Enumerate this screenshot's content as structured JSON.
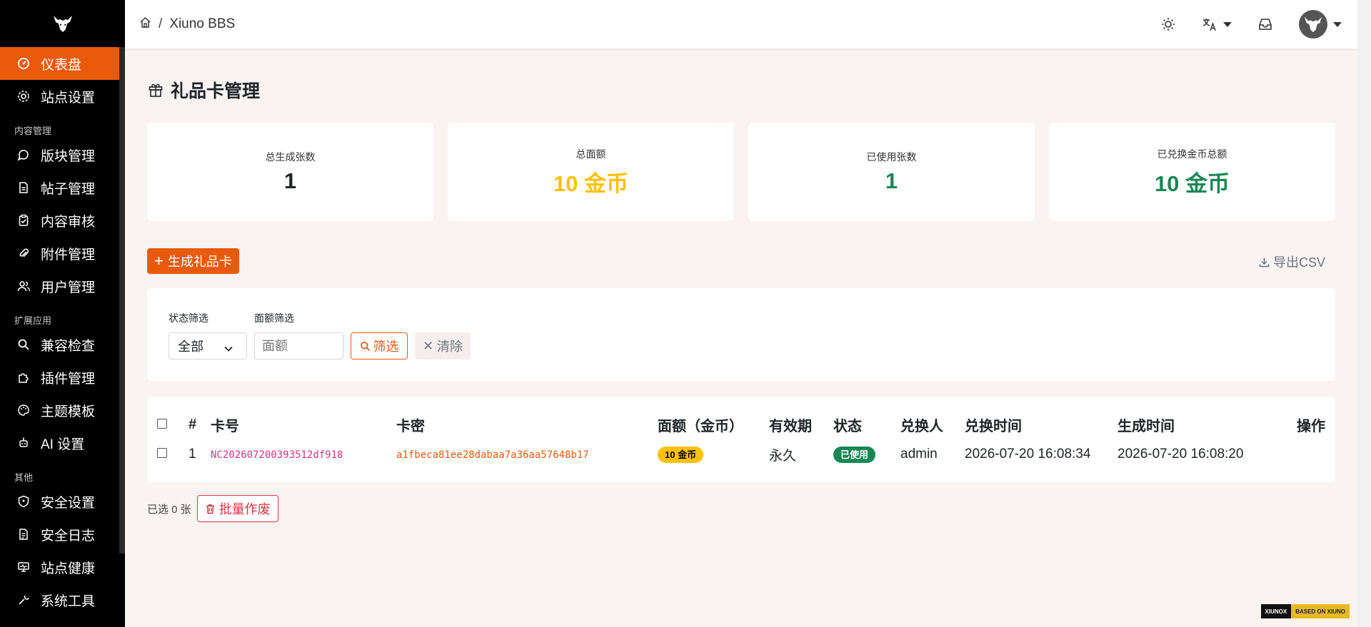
{
  "app": {
    "site_name": "Xiuno BBS"
  },
  "sidebar": {
    "items": [
      {
        "label": "仪表盘",
        "icon": "dashboard-icon",
        "active": true
      },
      {
        "label": "站点设置",
        "icon": "gear-icon"
      }
    ],
    "sections": [
      {
        "title": "内容管理",
        "items": [
          {
            "label": "版块管理",
            "icon": "chat-icon"
          },
          {
            "label": "帖子管理",
            "icon": "document-icon"
          },
          {
            "label": "内容审核",
            "icon": "clipboard-check-icon"
          },
          {
            "label": "附件管理",
            "icon": "paperclip-icon"
          },
          {
            "label": "用户管理",
            "icon": "users-icon"
          }
        ]
      },
      {
        "title": "扩展应用",
        "items": [
          {
            "label": "兼容检查",
            "icon": "search-icon"
          },
          {
            "label": "插件管理",
            "icon": "puzzle-icon"
          },
          {
            "label": "主题模板",
            "icon": "palette-icon"
          },
          {
            "label": "AI 设置",
            "icon": "robot-icon"
          }
        ]
      },
      {
        "title": "其他",
        "items": [
          {
            "label": "安全设置",
            "icon": "shield-icon"
          },
          {
            "label": "安全日志",
            "icon": "log-icon"
          },
          {
            "label": "站点健康",
            "icon": "monitor-icon"
          },
          {
            "label": "系统工具",
            "icon": "tools-icon"
          }
        ]
      }
    ]
  },
  "page": {
    "title": "礼品卡管理"
  },
  "stats": [
    {
      "label": "总生成张数",
      "value": "1",
      "color": "#212529"
    },
    {
      "label": "总面额",
      "value": "10 金币",
      "color": "#ffc107"
    },
    {
      "label": "已使用张数",
      "value": "1",
      "color": "#198754"
    },
    {
      "label": "已兑换金币总额",
      "value": "10 金币",
      "color": "#198754"
    }
  ],
  "actions": {
    "generate_label": "生成礼品卡",
    "export_label": "导出CSV"
  },
  "filter": {
    "status_label": "状态筛选",
    "status_value": "全部",
    "amount_label": "面额筛选",
    "amount_placeholder": "面额",
    "filter_button": "筛选",
    "clear_button": "清除"
  },
  "table": {
    "headers": [
      "#",
      "卡号",
      "卡密",
      "面额（金币）",
      "有效期",
      "状态",
      "兑换人",
      "兑换时间",
      "生成时间",
      "操作"
    ],
    "rows": [
      {
        "index": "1",
        "card_no": "NC202607200393512df918",
        "secret": "a1fbeca81ee28dabaa7a36aa57648b17",
        "amount": "10 金币",
        "validity": "永久",
        "status": "已使用",
        "redeemer": "admin",
        "redeem_time": "2026-07-20 16:08:34",
        "created_time": "2026-07-20 16:08:20"
      }
    ]
  },
  "footer": {
    "selected_text": "已选 0 张",
    "batch_void_label": "批量作废"
  },
  "brand_badge": {
    "left": "XIUNOX",
    "right": "BASED ON XIUNO"
  },
  "colors": {
    "accent": "#ea5a0c",
    "sidebar_bg": "#000000",
    "success": "#198754",
    "warning": "#ffc107",
    "danger": "#dc3545"
  }
}
